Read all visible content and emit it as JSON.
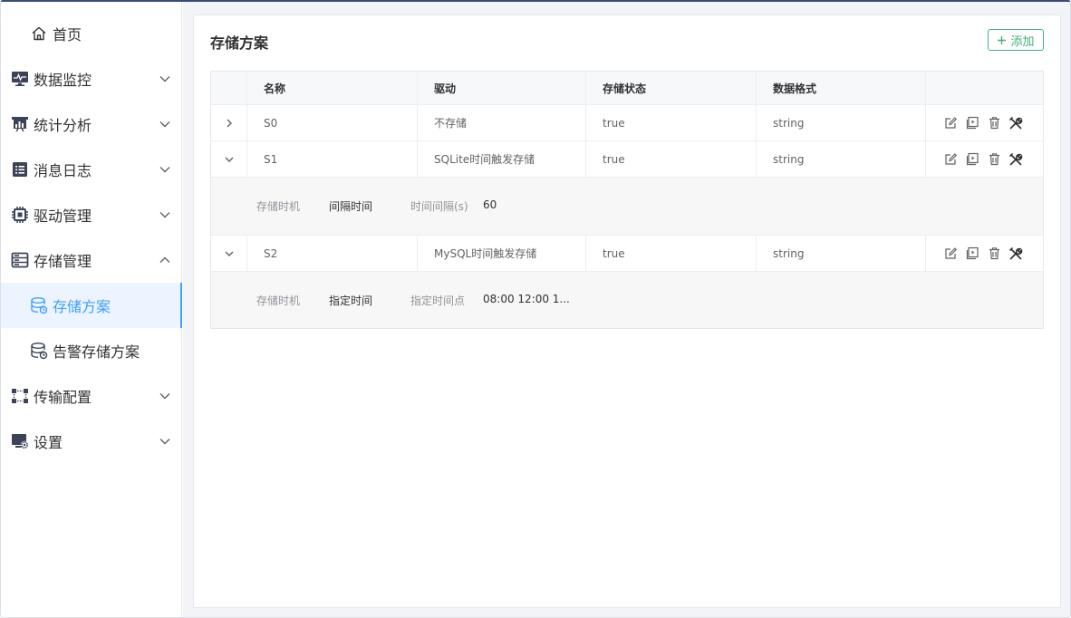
{
  "sidebar": {
    "home": "首页",
    "items": [
      {
        "label": "数据监控"
      },
      {
        "label": "统计分析"
      },
      {
        "label": "消息日志"
      },
      {
        "label": "驱动管理"
      },
      {
        "label": "存储管理"
      },
      {
        "label": "传输配置"
      },
      {
        "label": "设置"
      }
    ],
    "sub": [
      {
        "label": "存储方案"
      },
      {
        "label": "告警存储方案"
      }
    ]
  },
  "main": {
    "title": "存储方案",
    "add_label": "添加",
    "columns": [
      "名称",
      "驱动",
      "存储状态",
      "数据格式"
    ],
    "rows": [
      {
        "name": "S0",
        "driver": "不存储",
        "status": "true",
        "format": "string"
      },
      {
        "name": "S1",
        "driver": "SQLite时间触发存储",
        "status": "true",
        "format": "string",
        "detail": {
          "k1": "存储时机",
          "v1": "间隔时间",
          "k2": "时间间隔(s)",
          "v2": "60"
        }
      },
      {
        "name": "S2",
        "driver": "MySQL时间触发存储",
        "status": "true",
        "format": "string",
        "detail": {
          "k1": "存储时机",
          "v1": "指定时间",
          "k2": "指定时间点",
          "v2": "08:00 12:00 1..."
        }
      }
    ]
  },
  "colors": {
    "accent": "#409eff",
    "add_green": "#43b07a",
    "header_bar": "#3a4b7a"
  }
}
